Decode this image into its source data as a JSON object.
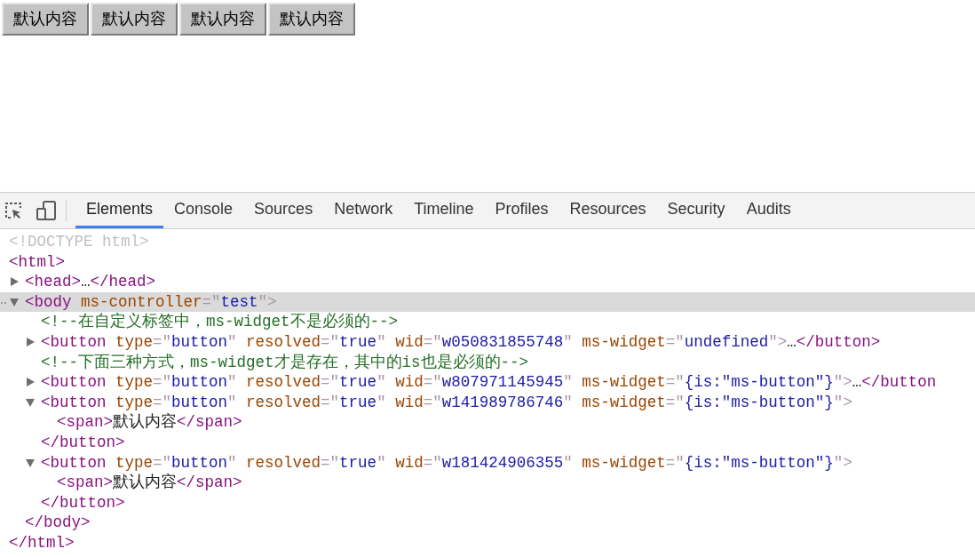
{
  "page_buttons": [
    "默认内容",
    "默认内容",
    "默认内容",
    "默认内容"
  ],
  "devtools": {
    "tabs": [
      {
        "label": "Elements",
        "selected": true
      },
      {
        "label": "Console",
        "selected": false
      },
      {
        "label": "Sources",
        "selected": false
      },
      {
        "label": "Network",
        "selected": false
      },
      {
        "label": "Timeline",
        "selected": false
      },
      {
        "label": "Profiles",
        "selected": false
      },
      {
        "label": "Resources",
        "selected": false
      },
      {
        "label": "Security",
        "selected": false
      },
      {
        "label": "Audits",
        "selected": false
      }
    ],
    "dom_tree": [
      {
        "selected": false,
        "tokens": [
          {
            "kind": "doctype",
            "text": "<!DOCTYPE html>"
          }
        ]
      },
      {
        "selected": false,
        "tokens": [
          {
            "kind": "tag",
            "text": "<html>"
          }
        ],
        "children": [
          {
            "selected": false,
            "expanded": false,
            "tokens": [
              {
                "kind": "tag",
                "text": "<head>"
              },
              {
                "kind": "text",
                "text": "…"
              },
              {
                "kind": "tag",
                "text": "</head>"
              }
            ]
          },
          {
            "selected": true,
            "expanded": true,
            "tokens": [
              {
                "kind": "tag",
                "text": "<body"
              },
              {
                "kind": "attr",
                "text": " ms-controller"
              },
              {
                "kind": "punct",
                "text": "=\""
              },
              {
                "kind": "value",
                "text": "test"
              },
              {
                "kind": "punct",
                "text": "\">"
              }
            ],
            "children": [
              {
                "selected": false,
                "tokens": [
                  {
                    "kind": "comment",
                    "text": "<!--在自定义标签中，ms-widget不是必须的-->"
                  }
                ]
              },
              {
                "selected": false,
                "expanded": false,
                "tokens": [
                  {
                    "kind": "tag",
                    "text": "<button"
                  },
                  {
                    "kind": "attr",
                    "text": " type"
                  },
                  {
                    "kind": "punct",
                    "text": "=\""
                  },
                  {
                    "kind": "value",
                    "text": "button"
                  },
                  {
                    "kind": "punct",
                    "text": "\""
                  },
                  {
                    "kind": "attr",
                    "text": " resolved"
                  },
                  {
                    "kind": "punct",
                    "text": "=\""
                  },
                  {
                    "kind": "value",
                    "text": "true"
                  },
                  {
                    "kind": "punct",
                    "text": "\""
                  },
                  {
                    "kind": "attr",
                    "text": " wid"
                  },
                  {
                    "kind": "punct",
                    "text": "=\""
                  },
                  {
                    "kind": "value",
                    "text": "w050831855748"
                  },
                  {
                    "kind": "punct",
                    "text": "\""
                  },
                  {
                    "kind": "attr",
                    "text": " ms-widget"
                  },
                  {
                    "kind": "punct",
                    "text": "=\""
                  },
                  {
                    "kind": "value",
                    "text": "undefined"
                  },
                  {
                    "kind": "punct",
                    "text": "\">"
                  },
                  {
                    "kind": "text",
                    "text": "…"
                  },
                  {
                    "kind": "tag",
                    "text": "</button>"
                  }
                ]
              },
              {
                "selected": false,
                "tokens": [
                  {
                    "kind": "comment",
                    "text": "<!--下面三种方式，ms-widget才是存在，其中的is也是必须的-->"
                  }
                ]
              },
              {
                "selected": false,
                "expanded": false,
                "tokens": [
                  {
                    "kind": "tag",
                    "text": "<button"
                  },
                  {
                    "kind": "attr",
                    "text": " type"
                  },
                  {
                    "kind": "punct",
                    "text": "=\""
                  },
                  {
                    "kind": "value",
                    "text": "button"
                  },
                  {
                    "kind": "punct",
                    "text": "\""
                  },
                  {
                    "kind": "attr",
                    "text": " resolved"
                  },
                  {
                    "kind": "punct",
                    "text": "=\""
                  },
                  {
                    "kind": "value",
                    "text": "true"
                  },
                  {
                    "kind": "punct",
                    "text": "\""
                  },
                  {
                    "kind": "attr",
                    "text": " wid"
                  },
                  {
                    "kind": "punct",
                    "text": "=\""
                  },
                  {
                    "kind": "value",
                    "text": "w807971145945"
                  },
                  {
                    "kind": "punct",
                    "text": "\""
                  },
                  {
                    "kind": "attr",
                    "text": " ms-widget"
                  },
                  {
                    "kind": "punct",
                    "text": "=\""
                  },
                  {
                    "kind": "value",
                    "text": "{is:\"ms-button\"}"
                  },
                  {
                    "kind": "punct",
                    "text": "\">"
                  },
                  {
                    "kind": "text",
                    "text": "…"
                  },
                  {
                    "kind": "tag",
                    "text": "</button"
                  }
                ]
              },
              {
                "selected": false,
                "expanded": true,
                "tokens": [
                  {
                    "kind": "tag",
                    "text": "<button"
                  },
                  {
                    "kind": "attr",
                    "text": " type"
                  },
                  {
                    "kind": "punct",
                    "text": "=\""
                  },
                  {
                    "kind": "value",
                    "text": "button"
                  },
                  {
                    "kind": "punct",
                    "text": "\""
                  },
                  {
                    "kind": "attr",
                    "text": " resolved"
                  },
                  {
                    "kind": "punct",
                    "text": "=\""
                  },
                  {
                    "kind": "value",
                    "text": "true"
                  },
                  {
                    "kind": "punct",
                    "text": "\""
                  },
                  {
                    "kind": "attr",
                    "text": " wid"
                  },
                  {
                    "kind": "punct",
                    "text": "=\""
                  },
                  {
                    "kind": "value",
                    "text": "w141989786746"
                  },
                  {
                    "kind": "punct",
                    "text": "\""
                  },
                  {
                    "kind": "attr",
                    "text": " ms-widget"
                  },
                  {
                    "kind": "punct",
                    "text": "=\""
                  },
                  {
                    "kind": "value",
                    "text": "{is:\"ms-button\"}"
                  },
                  {
                    "kind": "punct",
                    "text": "\">"
                  }
                ],
                "children": [
                  {
                    "selected": false,
                    "tokens": [
                      {
                        "kind": "tag",
                        "text": "<span>"
                      },
                      {
                        "kind": "text",
                        "text": "默认内容"
                      },
                      {
                        "kind": "tag",
                        "text": "</span>"
                      }
                    ]
                  }
                ],
                "closing": [
                  {
                    "kind": "tag",
                    "text": "</button>"
                  }
                ]
              },
              {
                "selected": false,
                "expanded": true,
                "tokens": [
                  {
                    "kind": "tag",
                    "text": "<button"
                  },
                  {
                    "kind": "attr",
                    "text": " type"
                  },
                  {
                    "kind": "punct",
                    "text": "=\""
                  },
                  {
                    "kind": "value",
                    "text": "button"
                  },
                  {
                    "kind": "punct",
                    "text": "\""
                  },
                  {
                    "kind": "attr",
                    "text": " resolved"
                  },
                  {
                    "kind": "punct",
                    "text": "=\""
                  },
                  {
                    "kind": "value",
                    "text": "true"
                  },
                  {
                    "kind": "punct",
                    "text": "\""
                  },
                  {
                    "kind": "attr",
                    "text": " wid"
                  },
                  {
                    "kind": "punct",
                    "text": "=\""
                  },
                  {
                    "kind": "value",
                    "text": "w181424906355"
                  },
                  {
                    "kind": "punct",
                    "text": "\""
                  },
                  {
                    "kind": "attr",
                    "text": " ms-widget"
                  },
                  {
                    "kind": "punct",
                    "text": "=\""
                  },
                  {
                    "kind": "value",
                    "text": "{is:\"ms-button\"}"
                  },
                  {
                    "kind": "punct",
                    "text": "\">"
                  }
                ],
                "children": [
                  {
                    "selected": false,
                    "tokens": [
                      {
                        "kind": "tag",
                        "text": "<span>"
                      },
                      {
                        "kind": "text",
                        "text": "默认内容"
                      },
                      {
                        "kind": "tag",
                        "text": "</span>"
                      }
                    ]
                  }
                ],
                "closing": [
                  {
                    "kind": "tag",
                    "text": "</button>"
                  }
                ]
              }
            ],
            "closing": [
              {
                "kind": "tag",
                "text": "</body>"
              }
            ]
          }
        ],
        "closing": [
          {
            "kind": "tag",
            "text": "</html>"
          }
        ]
      }
    ]
  }
}
